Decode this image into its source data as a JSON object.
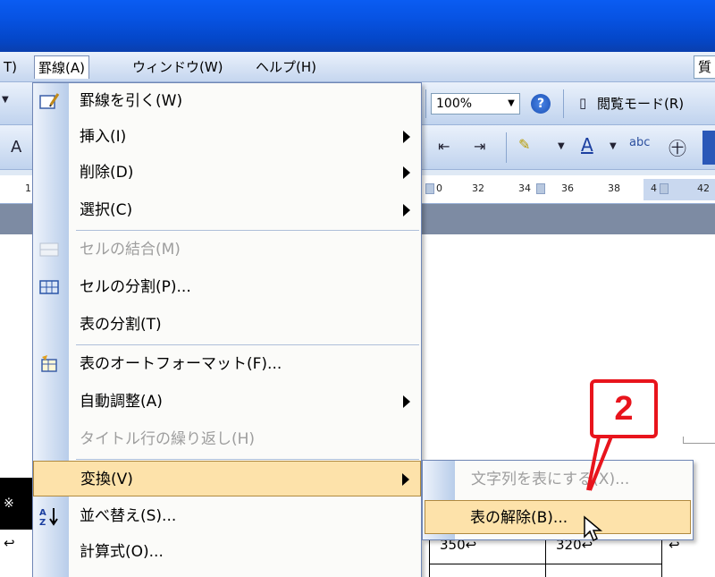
{
  "menubar": {
    "left_fragment": "T)",
    "items": [
      "罫線(A)",
      "ウィンドウ(W)",
      "ヘルプ(H)"
    ],
    "help_box_text": "質"
  },
  "toolbar": {
    "zoom": "100%",
    "read_mode": "閲覧モード(R)"
  },
  "ruler": {
    "left_number": "1",
    "numbers": [
      "32",
      "34",
      "36",
      "38",
      "42"
    ],
    "left_fragment": "0",
    "right_fragment": "4"
  },
  "dropdown": {
    "items": [
      {
        "label": "罫線を引く(W)",
        "icon": "draw-table-icon",
        "disabled": false,
        "submenu": false
      },
      {
        "label": "挿入(I)",
        "icon": "",
        "disabled": false,
        "submenu": true
      },
      {
        "label": "削除(D)",
        "icon": "",
        "disabled": false,
        "submenu": true
      },
      {
        "label": "選択(C)",
        "icon": "",
        "disabled": false,
        "submenu": true
      },
      {
        "label": "セルの結合(M)",
        "icon": "merge-cells-icon",
        "disabled": true,
        "submenu": false
      },
      {
        "label": "セルの分割(P)...",
        "icon": "split-cells-icon",
        "disabled": false,
        "submenu": false
      },
      {
        "label": "表の分割(T)",
        "icon": "",
        "disabled": false,
        "submenu": false
      },
      {
        "label": "表のオートフォーマット(F)...",
        "icon": "autoformat-icon",
        "disabled": false,
        "submenu": false
      },
      {
        "label": "自動調整(A)",
        "icon": "",
        "disabled": false,
        "submenu": true
      },
      {
        "label": "タイトル行の繰り返し(H)",
        "icon": "",
        "disabled": true,
        "submenu": false
      },
      {
        "label": "変換(V)",
        "icon": "",
        "disabled": false,
        "submenu": true,
        "highlight": true
      },
      {
        "label": "並べ替え(S)...",
        "icon": "sort-icon",
        "disabled": false,
        "submenu": false
      },
      {
        "label": "計算式(O)...",
        "icon": "",
        "disabled": false,
        "submenu": false
      }
    ]
  },
  "submenu": {
    "items": [
      {
        "label": "文字列を表にする(X)...",
        "disabled": true
      },
      {
        "label": "表の解除(B)...",
        "disabled": false,
        "highlight": true
      }
    ]
  },
  "callout": {
    "number": "2"
  },
  "document": {
    "cells": [
      "350↩",
      "320↩"
    ],
    "row_mark": "↩",
    "left_marks": [
      "↩"
    ],
    "black_cell_text": "※"
  },
  "colors": {
    "title_bar": "#0753e3",
    "highlight": "#fde2aa",
    "callout": "#e8141c"
  }
}
